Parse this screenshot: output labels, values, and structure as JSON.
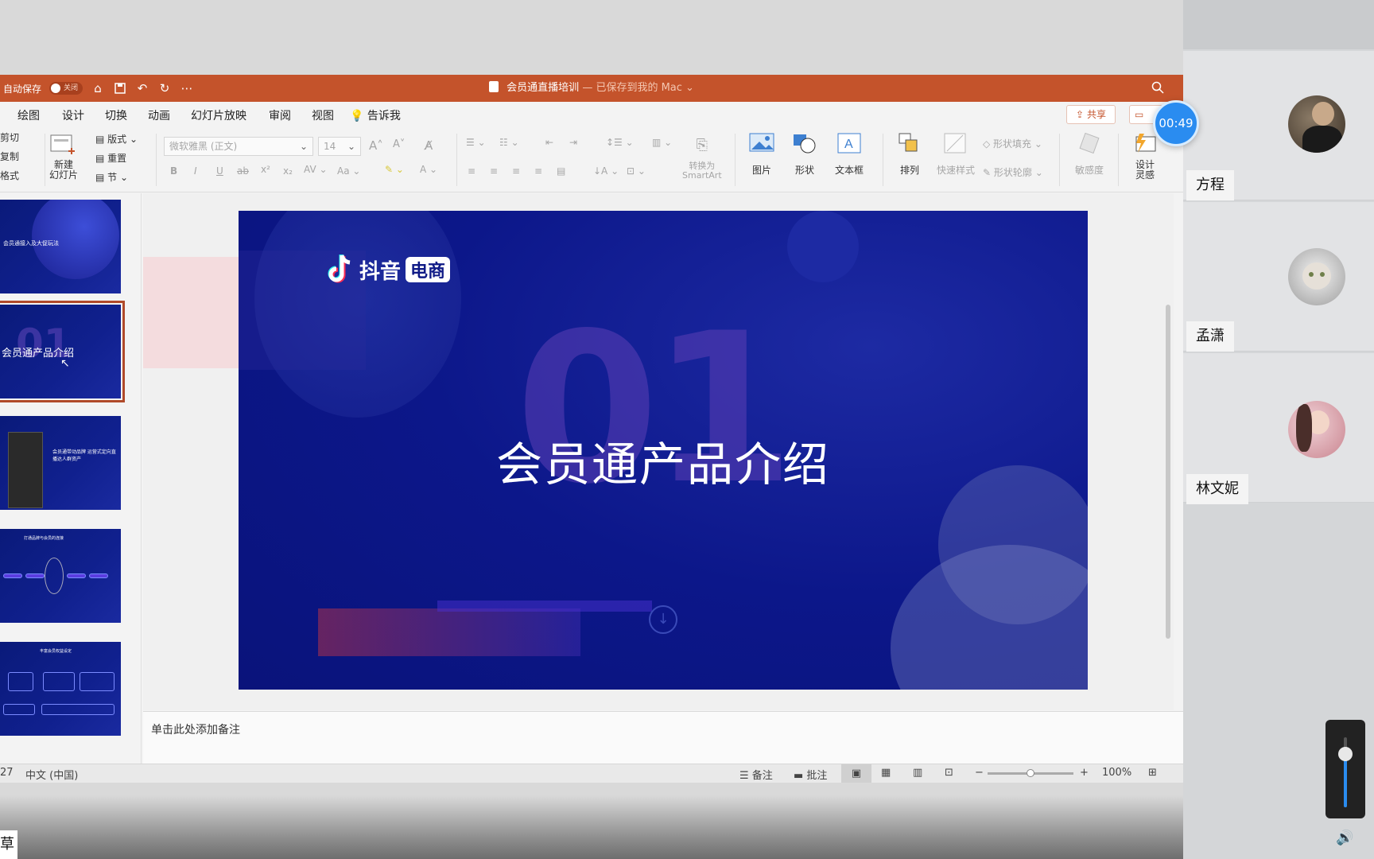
{
  "window": {
    "autosave_label": "自动保存",
    "autosave_state": "关闭",
    "doc_title": "会员通直播培训",
    "doc_status": "— 已保存到我的 Mac ⌄"
  },
  "menu": {
    "tabs": [
      "绘图",
      "设计",
      "切换",
      "动画",
      "幻灯片放映",
      "审阅",
      "视图"
    ],
    "tell_me": "告诉我",
    "share": "共享"
  },
  "ribbon": {
    "clipboard": [
      "剪切",
      "复制",
      "格式"
    ],
    "new_slide": [
      "新建",
      "幻灯片"
    ],
    "layout": "版式",
    "reset": "重置",
    "section": "节",
    "font_name": "微软雅黑 (正文)",
    "font_size": "14",
    "convert_smartart": [
      "转换为",
      "SmartArt"
    ],
    "picture": "图片",
    "shape": "形状",
    "textbox": "文本框",
    "arrange": "排列",
    "quick_styles": "快速样式",
    "shape_fill": "形状填充",
    "shape_outline": "形状轮廓",
    "sensitivity": "敏感度",
    "designer": [
      "设计",
      "灵感"
    ]
  },
  "thumbnails": [
    {
      "text": "会员通接入及大促玩法"
    },
    {
      "text": "会员通产品介绍"
    },
    {
      "text": "会员通带动品牌 运营式定向直播达人群资产"
    },
    {
      "text": "打通品牌与会员的连接"
    },
    {
      "text": "丰富会员权益设定"
    }
  ],
  "slide": {
    "logo_text": "抖音",
    "logo_box": "电商",
    "big_number": "01",
    "title": "会员通产品介绍"
  },
  "notes_placeholder": "单击此处添加备注",
  "status": {
    "slide_count": "27",
    "language": "中文 (中国)",
    "notes": "备注",
    "comments": "批注",
    "zoom": "100%",
    "zoom_level": 0.5
  },
  "timer": "00:49",
  "participants": [
    {
      "name": "方程"
    },
    {
      "name": "孟潇"
    },
    {
      "name": "林文妮"
    }
  ],
  "volume_level": 0.75,
  "corner_text": "草",
  "colors": {
    "titlebar": "#c4532b",
    "slide_bg": "#0f1a86",
    "timer": "#2a8cf0"
  }
}
